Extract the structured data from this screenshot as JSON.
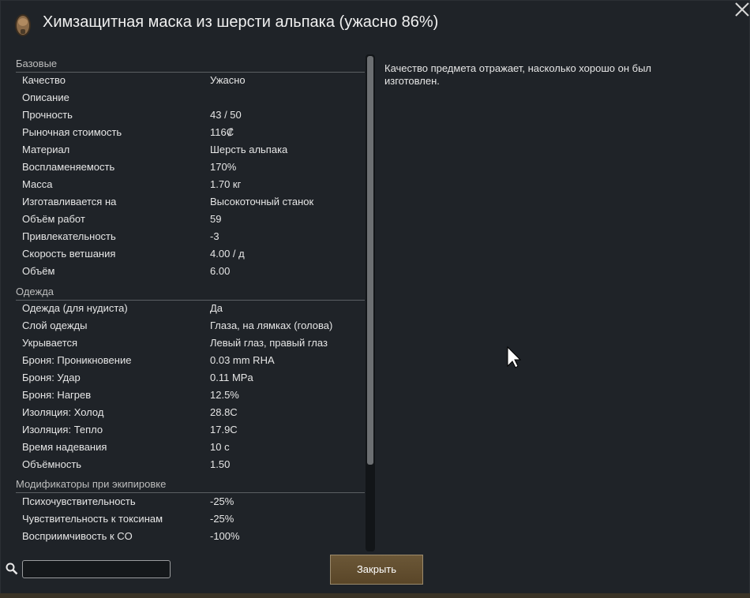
{
  "window": {
    "title": "Химзащитная маска из шерсти альпака (ужасно 86%)",
    "title_icon": "gas-mask-icon",
    "close_icon": "close-x-icon"
  },
  "sections": [
    {
      "name": "Базовые",
      "rows": [
        {
          "label": "Качество",
          "value": "Ужасно"
        },
        {
          "label": "Описание",
          "value": ""
        },
        {
          "label": "Прочность",
          "value": "43 / 50"
        },
        {
          "label": "Рыночная стоимость",
          "value": "116₡"
        },
        {
          "label": "Материал",
          "value": "Шерсть альпака"
        },
        {
          "label": "Воспламеняемость",
          "value": "170%"
        },
        {
          "label": "Масса",
          "value": "1.70 кг"
        },
        {
          "label": "Изготавливается на",
          "value": "Высокоточный станок"
        },
        {
          "label": "Объём работ",
          "value": "59"
        },
        {
          "label": "Привлекательность",
          "value": "-3"
        },
        {
          "label": "Скорость ветшания",
          "value": "4.00 / д"
        },
        {
          "label": "Объём",
          "value": "6.00"
        }
      ]
    },
    {
      "name": "Одежда",
      "rows": [
        {
          "label": "Одежда (для нудиста)",
          "value": "Да"
        },
        {
          "label": "Слой одежды",
          "value": "Глаза, на лямках (голова)"
        },
        {
          "label": "Укрывается",
          "value": "Левый глаз, правый глаз"
        },
        {
          "label": "Броня: Проникновение",
          "value": "0.03 mm RHA"
        },
        {
          "label": "Броня: Удар",
          "value": "0.11 MPa"
        },
        {
          "label": "Броня: Нагрев",
          "value": "12.5%"
        },
        {
          "label": "Изоляция: Холод",
          "value": "28.8C"
        },
        {
          "label": "Изоляция: Тепло",
          "value": "17.9C"
        },
        {
          "label": "Время надевания",
          "value": "10 с"
        },
        {
          "label": "Объёмность",
          "value": "1.50"
        }
      ]
    },
    {
      "name": "Модификаторы при экипировке",
      "rows": [
        {
          "label": "Психочувствительность",
          "value": "-25%"
        },
        {
          "label": "Чувствительность к токсинам",
          "value": "-25%"
        },
        {
          "label": "Восприимчивость к CO",
          "value": "-100%"
        }
      ]
    }
  ],
  "description": "Качество предмета отражает, насколько хорошо он был изготовлен.",
  "search": {
    "icon": "magnifier-icon",
    "value": "",
    "placeholder": ""
  },
  "buttons": {
    "close_label": "Закрыть"
  },
  "colors": {
    "window_bg": "#1f2328",
    "button_bg": "#5f4b2d",
    "text": "#e6e6e6"
  }
}
